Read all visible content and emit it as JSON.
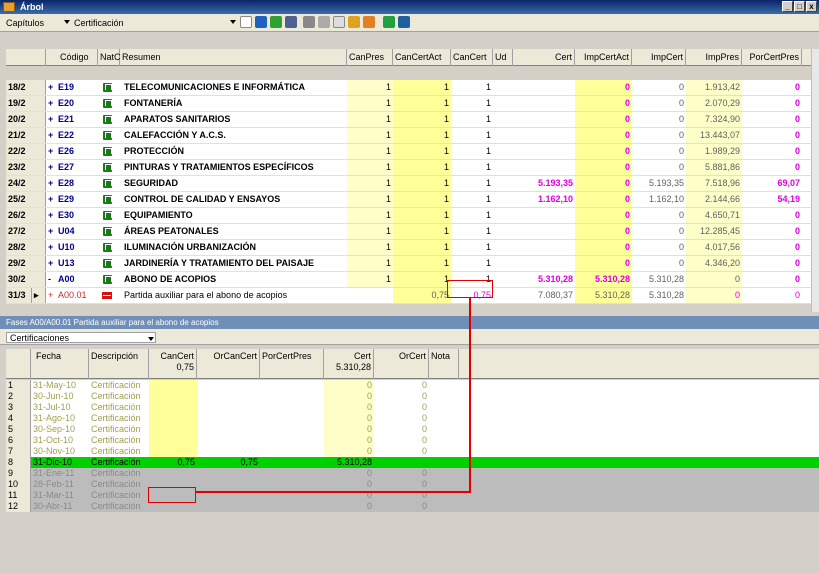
{
  "window": {
    "title": "Árbol",
    "min": "_",
    "max": "□",
    "close": "x"
  },
  "toolbar": {
    "level_label": "Capítulos",
    "view_label": "Certificación"
  },
  "grid": {
    "headers": [
      "Código",
      "NatC",
      "Resumen",
      "CanPres",
      "CanCertAct",
      "CanCert",
      "Ud",
      "Cert",
      "ImpCertAct",
      "ImpCert",
      "ImpPres",
      "PorCertPres"
    ],
    "rows": [
      {
        "idx": "18/2",
        "exp": "+",
        "code": "E19",
        "summary": "TELECOMUNICACIONES E INFORMÁTICA",
        "canpres": "1",
        "cancertact": "1",
        "cancert": "1",
        "cert": "",
        "impcertact": "0",
        "impcert": "0",
        "imppres": "1.913,42",
        "porcert": "0"
      },
      {
        "idx": "19/2",
        "exp": "+",
        "code": "E20",
        "summary": "FONTANERÍA",
        "canpres": "1",
        "cancertact": "1",
        "cancert": "1",
        "cert": "",
        "impcertact": "0",
        "impcert": "0",
        "imppres": "2.070,29",
        "porcert": "0"
      },
      {
        "idx": "20/2",
        "exp": "+",
        "code": "E21",
        "summary": "APARATOS SANITARIOS",
        "canpres": "1",
        "cancertact": "1",
        "cancert": "1",
        "cert": "",
        "impcertact": "0",
        "impcert": "0",
        "imppres": "7.324,90",
        "porcert": "0"
      },
      {
        "idx": "21/2",
        "exp": "+",
        "code": "E22",
        "summary": "CALEFACCIÓN Y A.C.S.",
        "canpres": "1",
        "cancertact": "1",
        "cancert": "1",
        "cert": "",
        "impcertact": "0",
        "impcert": "0",
        "imppres": "13.443,07",
        "porcert": "0"
      },
      {
        "idx": "22/2",
        "exp": "+",
        "code": "E26",
        "summary": "PROTECCIÓN",
        "canpres": "1",
        "cancertact": "1",
        "cancert": "1",
        "cert": "",
        "impcertact": "0",
        "impcert": "0",
        "imppres": "1.989,29",
        "porcert": "0"
      },
      {
        "idx": "23/2",
        "exp": "+",
        "code": "E27",
        "summary": "PINTURAS Y TRATAMIENTOS ESPECÍFICOS",
        "canpres": "1",
        "cancertact": "1",
        "cancert": "1",
        "cert": "",
        "impcertact": "0",
        "impcert": "0",
        "imppres": "5.881,86",
        "porcert": "0"
      },
      {
        "idx": "24/2",
        "exp": "+",
        "code": "E28",
        "summary": "SEGURIDAD",
        "canpres": "1",
        "cancertact": "1",
        "cancert": "1",
        "cert": "5.193,35",
        "impcertact": "0",
        "impcert": "5.193,35",
        "imppres": "7.518,96",
        "porcert": "69,07"
      },
      {
        "idx": "25/2",
        "exp": "+",
        "code": "E29",
        "summary": "CONTROL DE CALIDAD Y ENSAYOS",
        "canpres": "1",
        "cancertact": "1",
        "cancert": "1",
        "cert": "1.162,10",
        "impcertact": "0",
        "impcert": "1.162,10",
        "imppres": "2.144,66",
        "porcert": "54,19"
      },
      {
        "idx": "26/2",
        "exp": "+",
        "code": "E30",
        "summary": "EQUIPAMIENTO",
        "canpres": "1",
        "cancertact": "1",
        "cancert": "1",
        "cert": "",
        "impcertact": "0",
        "impcert": "0",
        "imppres": "4.650,71",
        "porcert": "0"
      },
      {
        "idx": "27/2",
        "exp": "+",
        "code": "U04",
        "summary": "ÁREAS PEATONALES",
        "canpres": "1",
        "cancertact": "1",
        "cancert": "1",
        "cert": "",
        "impcertact": "0",
        "impcert": "0",
        "imppres": "12.285,45",
        "porcert": "0"
      },
      {
        "idx": "28/2",
        "exp": "+",
        "code": "U10",
        "summary": "ILUMINACIÓN URBANIZACIÓN",
        "canpres": "1",
        "cancertact": "1",
        "cancert": "1",
        "cert": "",
        "impcertact": "0",
        "impcert": "0",
        "imppres": "4.017,56",
        "porcert": "0"
      },
      {
        "idx": "29/2",
        "exp": "+",
        "code": "U13",
        "summary": "JARDINERÍA Y TRATAMIENTO DEL PAISAJE",
        "canpres": "1",
        "cancertact": "1",
        "cancert": "1",
        "cert": "",
        "impcertact": "0",
        "impcert": "0",
        "imppres": "4.346,20",
        "porcert": "0"
      },
      {
        "idx": "30/2",
        "exp": "-",
        "code": "A00",
        "summary": "ABONO DE ACOPIOS",
        "canpres": "1",
        "cancertact": "1",
        "cancert": "1",
        "cert": "5.310,28",
        "impcertact": "5.310,28",
        "impcert": "5.310,28",
        "imppres": "0",
        "porcert": "0"
      }
    ],
    "sub": {
      "idx": "31/3",
      "arrow": "▸",
      "exp": "+",
      "code": "A00.01",
      "summary": "Partida auxiliar para el abono de acopios",
      "cancertact": "0,75",
      "cancert": "0,75",
      "cert": "7.080,37",
      "impcertact": "5.310,28",
      "impcert": "5.310,28",
      "imppres": "0",
      "porcert": "0"
    }
  },
  "panel": {
    "title": "Fases A00/A00.01 Partida auxiliar para el abono de acopios",
    "dropdown": "Certificaciones",
    "headers": {
      "fecha": "Fecha",
      "desc": "Descripción",
      "cancert": "CanCert",
      "cancert_sum": "0,75",
      "orcancert": "OrCanCert",
      "porcertpres": "PorCertPres",
      "cert": "Cert",
      "cert_sum": "5.310,28",
      "orcert": "OrCert",
      "nota": "Nota"
    },
    "rows": [
      {
        "n": "1",
        "fecha": "31-May-10",
        "desc": "Certificación",
        "cancert": "",
        "orcancert": "",
        "cert": "0",
        "orcert": "0"
      },
      {
        "n": "2",
        "fecha": "30-Jun-10",
        "desc": "Certificación",
        "cancert": "",
        "orcancert": "",
        "cert": "0",
        "orcert": "0"
      },
      {
        "n": "3",
        "fecha": "31-Jul-10",
        "desc": "Certificación",
        "cancert": "",
        "orcancert": "",
        "cert": "0",
        "orcert": "0"
      },
      {
        "n": "4",
        "fecha": "31-Ago-10",
        "desc": "Certificación",
        "cancert": "",
        "orcancert": "",
        "cert": "0",
        "orcert": "0"
      },
      {
        "n": "5",
        "fecha": "30-Sep-10",
        "desc": "Certificación",
        "cancert": "",
        "orcancert": "",
        "cert": "0",
        "orcert": "0"
      },
      {
        "n": "6",
        "fecha": "31-Oct-10",
        "desc": "Certificación",
        "cancert": "",
        "orcancert": "",
        "cert": "0",
        "orcert": "0"
      },
      {
        "n": "7",
        "fecha": "30-Nov-10",
        "desc": "Certificación",
        "cancert": "",
        "orcancert": "",
        "cert": "0",
        "orcert": "0"
      },
      {
        "n": "8",
        "fecha": "31-Dic-10",
        "desc": "Certificación",
        "cancert": "0,75",
        "orcancert": "0,75",
        "cert": "5.310,28",
        "orcert": ""
      },
      {
        "n": "9",
        "fecha": "31-Ene-11",
        "desc": "Certificación",
        "cancert": "",
        "orcancert": "",
        "cert": "0",
        "orcert": "0"
      },
      {
        "n": "10",
        "fecha": "28-Feb-11",
        "desc": "Certificación",
        "cancert": "",
        "orcancert": "",
        "cert": "0",
        "orcert": "0"
      },
      {
        "n": "11",
        "fecha": "31-Mar-11",
        "desc": "Certificación",
        "cancert": "",
        "orcancert": "",
        "cert": "0",
        "orcert": "0"
      },
      {
        "n": "12",
        "fecha": "30-Abr-11",
        "desc": "Certificación",
        "cancert": "",
        "orcancert": "",
        "cert": "0",
        "orcert": "0"
      }
    ]
  },
  "colors": {
    "titlebar": "#0a246a",
    "panelbar": "#6f8fb8",
    "highlight": "#00d000",
    "annotation": "#e00000",
    "magenta": "#e000e0"
  }
}
